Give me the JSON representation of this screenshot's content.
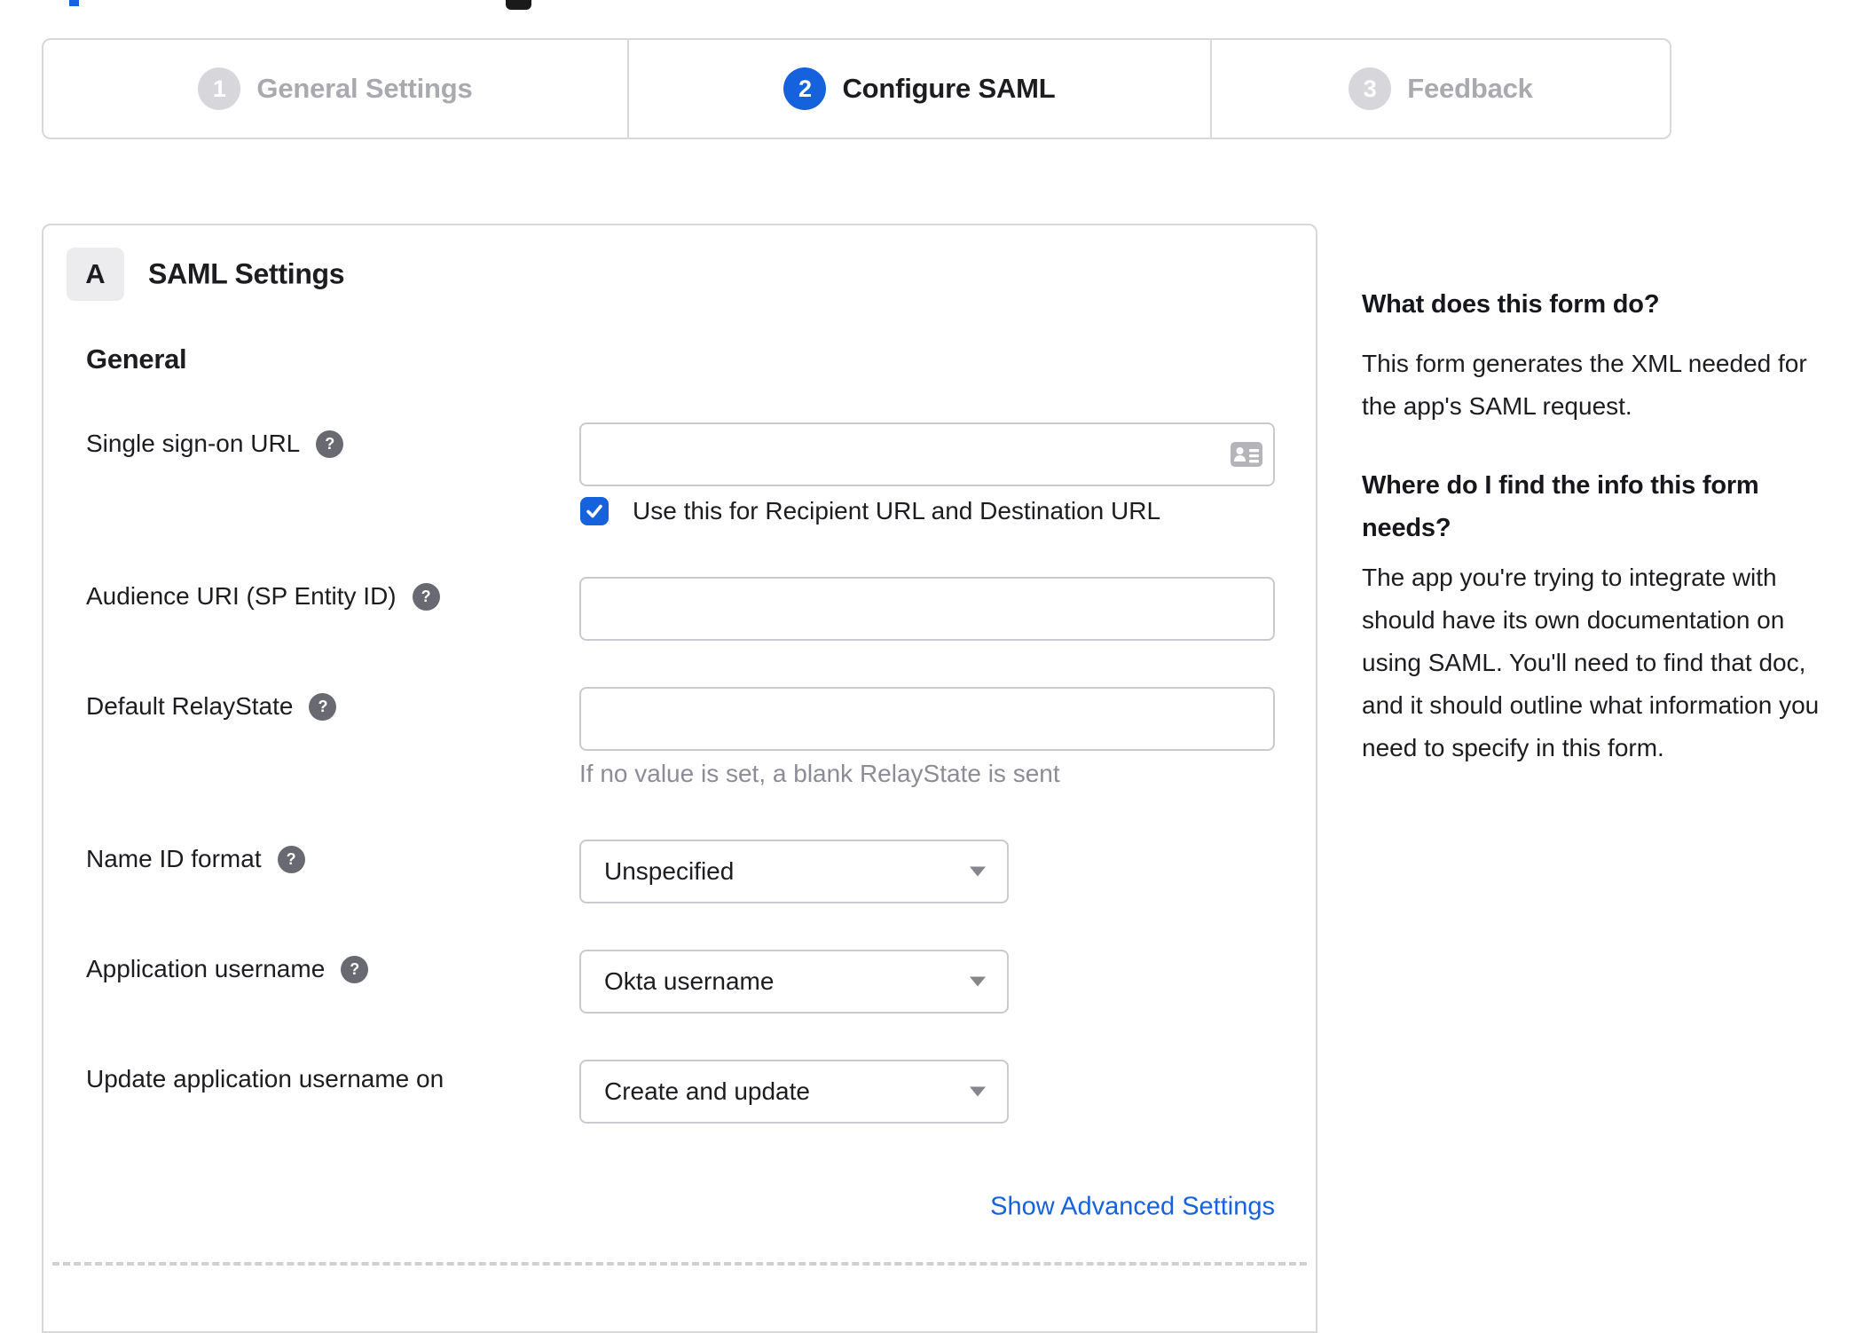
{
  "stepper": {
    "steps": [
      {
        "number": "1",
        "label": "General Settings",
        "state": "inactive"
      },
      {
        "number": "2",
        "label": "Configure SAML",
        "state": "active"
      },
      {
        "number": "3",
        "label": "Feedback",
        "state": "inactive"
      }
    ]
  },
  "panel": {
    "section_badge": "A",
    "section_title": "SAML Settings",
    "group_heading": "General",
    "fields": {
      "sso": {
        "label": "Single sign-on URL",
        "value": "",
        "checkbox_label": "Use this for Recipient URL and Destination URL",
        "checkbox_checked": true
      },
      "audience": {
        "label": "Audience URI (SP Entity ID)",
        "value": ""
      },
      "relay": {
        "label": "Default RelayState",
        "value": "",
        "helper": "If no value is set, a blank RelayState is sent"
      },
      "nameid": {
        "label": "Name ID format",
        "value": "Unspecified"
      },
      "appuser": {
        "label": "Application username",
        "value": "Okta username"
      },
      "updateuser": {
        "label": "Update application username on",
        "value": "Create and update"
      }
    },
    "advanced_link": "Show Advanced Settings"
  },
  "sidebar": {
    "q1": "What does this form do?",
    "a1": "This form generates the XML needed for the app's SAML request.",
    "q2": "Where do I find the info this form needs?",
    "a2": "The app you're trying to integrate with should have its own documentation on using SAML. You'll need to find that doc, and it should outline what information you need to specify in this form."
  },
  "icons": {
    "help": "?"
  },
  "colors": {
    "accent_blue": "#1662dd",
    "inactive_circle_gray": "#d6d6db",
    "inactive_text_gray": "#a9a9b0",
    "border_gray": "#d7d7dc",
    "input_border_gray": "#c9c9cf",
    "helper_text_gray": "#8c8c96",
    "help_icon_gray": "#696971",
    "text_dark": "#1d1d21"
  }
}
